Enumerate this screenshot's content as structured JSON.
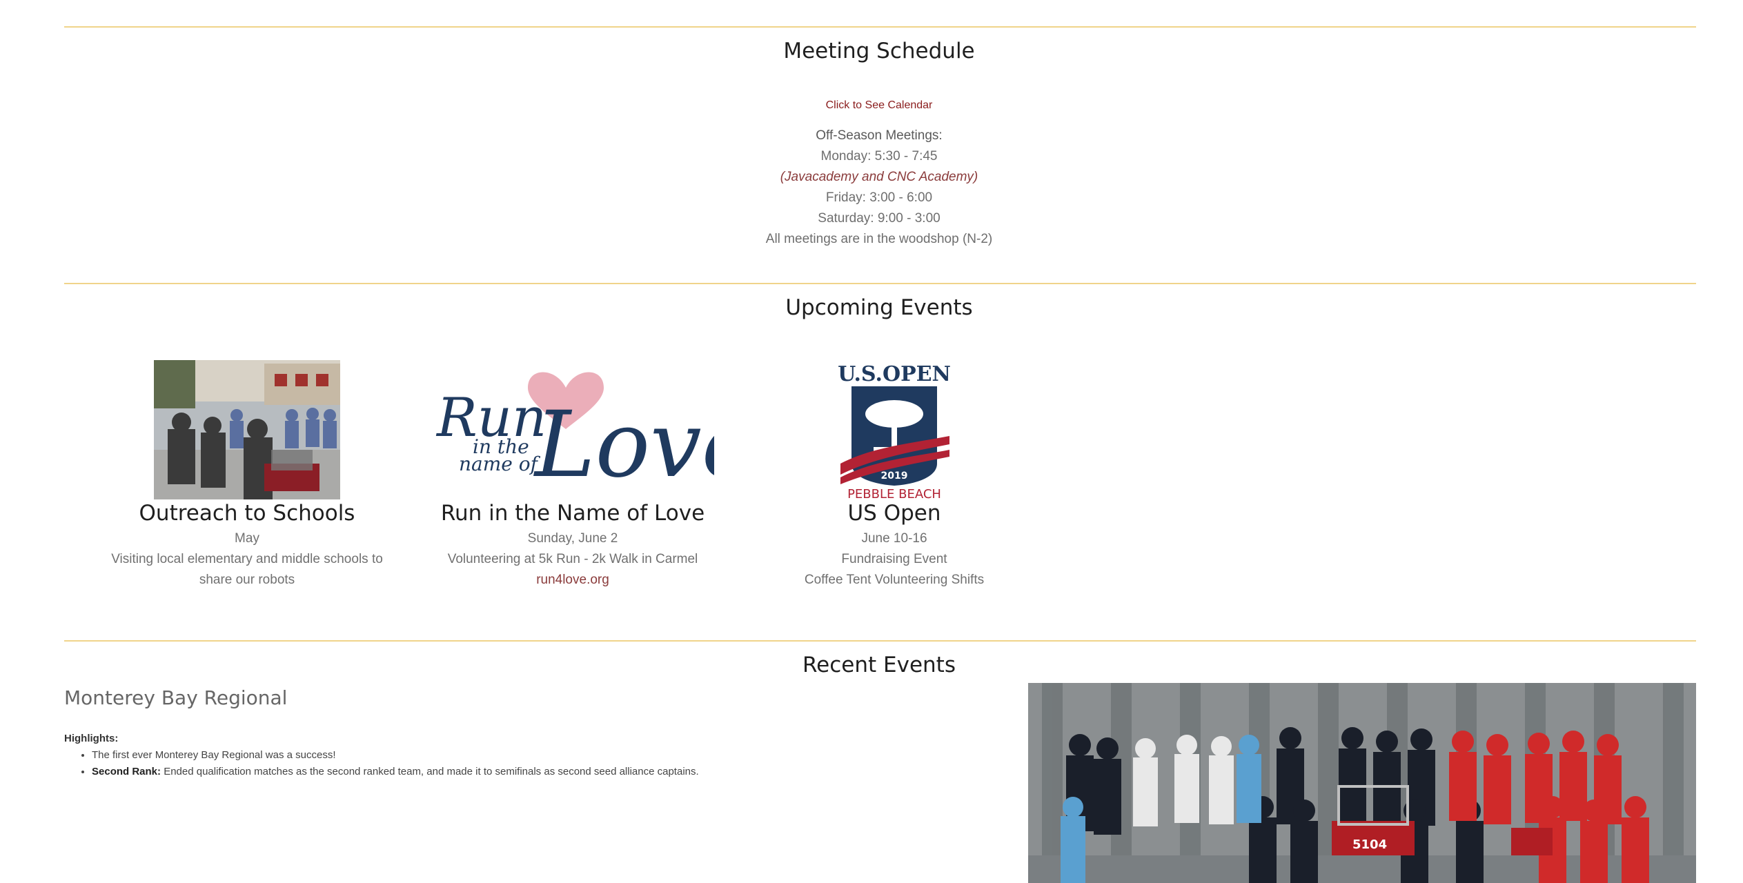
{
  "meeting": {
    "title": "Meeting Schedule",
    "calendar_link": "Click to See Calendar",
    "offseason_label": "Off-Season Meetings:",
    "monday": "Monday: 5:30 - 7:45",
    "monday_note": "(Javacademy and CNC Academy)",
    "friday": "Friday: 3:00 - 6:00",
    "saturday": "Saturday: 9:00 - 3:00",
    "location": "All meetings are in the woodshop (N-2)"
  },
  "upcoming": {
    "title": "Upcoming Events",
    "events": [
      {
        "title": "Outreach to Schools",
        "date": "May",
        "desc1": "Visiting local elementary and middle schools to",
        "desc2": "share our robots",
        "image_icon": "outreach-photo"
      },
      {
        "title": "Run in the Name of Love",
        "date": "Sunday, June 2",
        "desc1": "Volunteering at 5k Run - 2k Walk in Carmel",
        "link": "run4love.org",
        "logo_text_run": "Run",
        "logo_text_in": "in the",
        "logo_text_name": "name of",
        "logo_text_love": "Love",
        "image_icon": "run-for-love-logo"
      },
      {
        "title": "US Open",
        "date": "June 10-16",
        "desc1": "Fundraising Event",
        "desc2": "Coffee Tent Volunteering Shifts",
        "logo_top": "U.S.OPEN",
        "logo_year": "2019",
        "logo_bottom": "PEBBLE BEACH",
        "image_icon": "us-open-logo"
      }
    ]
  },
  "recent": {
    "title": "Recent Events",
    "event_name": "Monterey Bay Regional",
    "highlights_label": "Highlights:",
    "bullet1": "The first ever Monterey Bay Regional was a success!",
    "bullet2_bold": "Second Rank:",
    "bullet2_text": "Ended qualification matches as the second ranked team, and made it to semifinals as second seed alliance captains.",
    "robot_number": "5104"
  },
  "colors": {
    "rule": "#f0d48a",
    "link": "#8a1c1c",
    "heading": "#1f1f1f",
    "navy": "#1f3a5f",
    "red": "#b22234"
  }
}
